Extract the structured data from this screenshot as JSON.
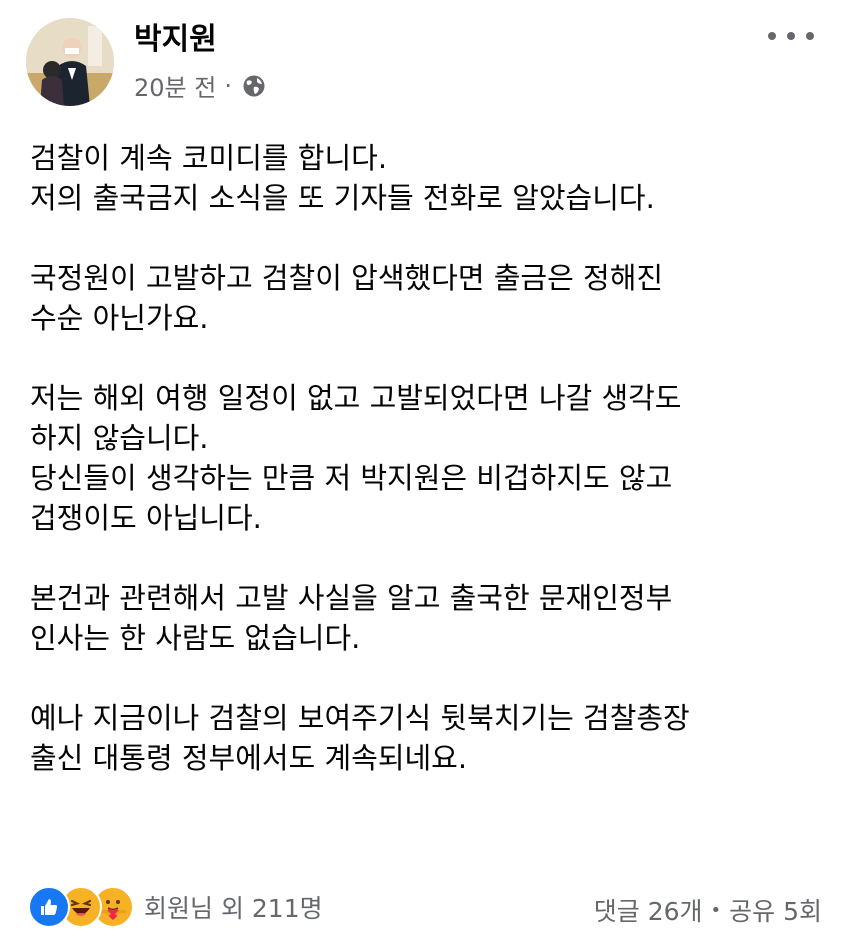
{
  "post": {
    "author": "박지원",
    "time": "20분 전",
    "separator": "·",
    "privacy_icon": "globe-icon",
    "menu_icon": "more-options-icon",
    "paragraphs": [
      [
        "검찰이 계속 코미디를 합니다.",
        "저의 출국금지 소식을 또 기자들 전화로 알았습니다."
      ],
      [
        "국정원이 고발하고 검찰이 압색했다면 출금은 정해진",
        "수순 아닌가요."
      ],
      [
        "저는 해외 여행 일정이 없고 고발되었다면 나갈 생각도",
        "하지 않습니다.",
        "당신들이 생각하는 만큼 저 박지원은 비겁하지도 않고",
        "겁쟁이도 아닙니다."
      ],
      [
        "본건과 관련해서 고발 사실을 알고 출국한 문재인정부",
        "인사는 한 사람도 없습니다."
      ],
      [
        "예나 지금이나 검찰의 보여주기식 뒷북치기는 검찰총장",
        "출신 대통령 정부에서도 계속되네요."
      ]
    ]
  },
  "footer": {
    "reactions": [
      "like-icon",
      "haha-icon",
      "care-icon"
    ],
    "reaction_text": "회원님 외 211명",
    "comments": "댓글 26개",
    "dot": "•",
    "shares": "공유 5회"
  },
  "colors": {
    "text": "#050505",
    "secondary": "#65676b",
    "like_blue": "#1877f2",
    "emoji_yellow": "#f7b125"
  }
}
